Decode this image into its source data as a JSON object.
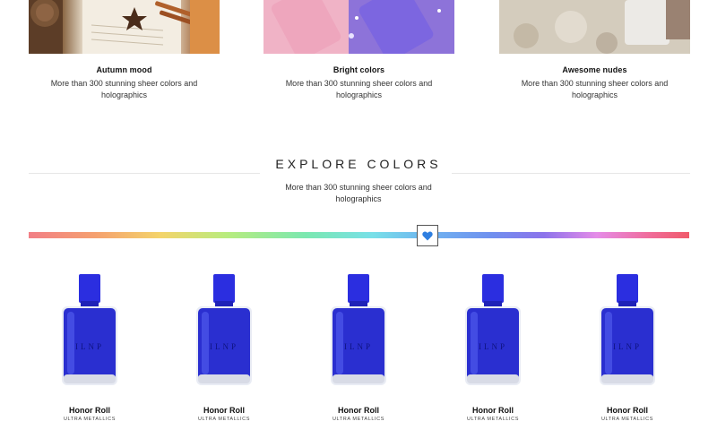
{
  "collections": [
    {
      "title": "Autumn mood",
      "description": "More than 300 stunning sheer colors and holographics"
    },
    {
      "title": "Bright colors",
      "description": "More than 300 stunning sheer colors and holographics"
    },
    {
      "title": "Awesome nudes",
      "description": "More than 300 stunning sheer colors and holographics"
    }
  ],
  "explore": {
    "title": "EXPLORE COLORS",
    "description": "More than 300 stunning sheer colors and holographics",
    "selector_icon": "heart-icon",
    "accent_color": "#2f7fe0"
  },
  "bottle_brand": "ILNP",
  "products": [
    {
      "name": "Honor Roll",
      "category": "ULTRA METALLICS",
      "polish_color": "#2a2fd0"
    },
    {
      "name": "Honor Roll",
      "category": "ULTRA METALLICS",
      "polish_color": "#2a2fd0"
    },
    {
      "name": "Honor Roll",
      "category": "ULTRA METALLICS",
      "polish_color": "#2a2fd0"
    },
    {
      "name": "Honor Roll",
      "category": "ULTRA METALLICS",
      "polish_color": "#2a2fd0"
    },
    {
      "name": "Honor Roll",
      "category": "ULTRA METALLICS",
      "polish_color": "#2a2fd0"
    }
  ]
}
